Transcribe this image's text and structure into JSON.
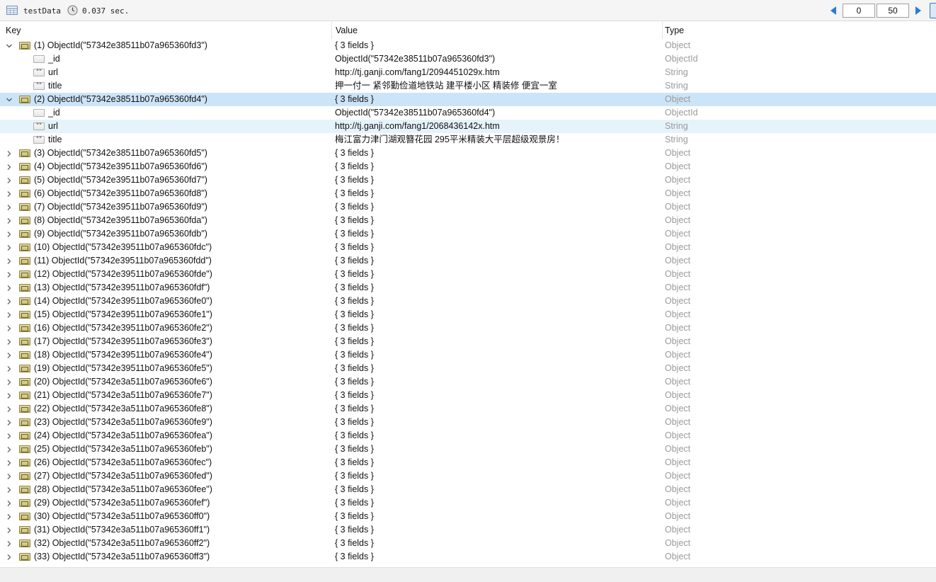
{
  "toolbar": {
    "collection": "testData",
    "time": "0.037 sec.",
    "skip": "0",
    "limit": "50",
    "icons": [
      "table-icon",
      "clock-icon",
      "prev-page-icon",
      "next-page-icon"
    ]
  },
  "columns": {
    "key": "Key",
    "value": "Value",
    "type": "Type"
  },
  "colors": {
    "selected_row": "#cce4f7",
    "hover_row": "#e5f3fb",
    "type_text": "#9a9a9a",
    "accent": "#1f78d1"
  },
  "rows": [
    {
      "level": 0,
      "expanded": true,
      "icon": "object",
      "key": "(1) ObjectId(\"57342e38511b07a965360fd3\")",
      "value": "{ 3 fields }",
      "type": "Object"
    },
    {
      "level": 1,
      "icon": "objectid",
      "key": "_id",
      "value": "ObjectId(\"57342e38511b07a965360fd3\")",
      "type": "ObjectId"
    },
    {
      "level": 1,
      "icon": "string",
      "key": "url",
      "value": "http://tj.ganji.com/fang1/2094451029x.htm",
      "type": "String"
    },
    {
      "level": 1,
      "icon": "string",
      "key": "title",
      "value": "押一付一 紧邻勤俭道地铁站 建平楼小区 精装修 便宜一室",
      "type": "String"
    },
    {
      "level": 0,
      "expanded": true,
      "selected": true,
      "icon": "object",
      "key": "(2) ObjectId(\"57342e38511b07a965360fd4\")",
      "value": "{ 3 fields }",
      "type": "Object"
    },
    {
      "level": 1,
      "icon": "objectid",
      "key": "_id",
      "value": "ObjectId(\"57342e38511b07a965360fd4\")",
      "type": "ObjectId"
    },
    {
      "level": 1,
      "hover": true,
      "icon": "string",
      "key": "url",
      "value": "http://tj.ganji.com/fang1/2068436142x.htm",
      "type": "String"
    },
    {
      "level": 1,
      "icon": "string",
      "key": "title",
      "value": "梅江富力津门湖观簪花园 295平米精装大平层超级观景房！",
      "type": "String"
    },
    {
      "level": 0,
      "icon": "object",
      "key": "(3) ObjectId(\"57342e38511b07a965360fd5\")",
      "value": "{ 3 fields }",
      "type": "Object"
    },
    {
      "level": 0,
      "icon": "object",
      "key": "(4) ObjectId(\"57342e39511b07a965360fd6\")",
      "value": "{ 3 fields }",
      "type": "Object"
    },
    {
      "level": 0,
      "icon": "object",
      "key": "(5) ObjectId(\"57342e39511b07a965360fd7\")",
      "value": "{ 3 fields }",
      "type": "Object"
    },
    {
      "level": 0,
      "icon": "object",
      "key": "(6) ObjectId(\"57342e39511b07a965360fd8\")",
      "value": "{ 3 fields }",
      "type": "Object"
    },
    {
      "level": 0,
      "icon": "object",
      "key": "(7) ObjectId(\"57342e39511b07a965360fd9\")",
      "value": "{ 3 fields }",
      "type": "Object"
    },
    {
      "level": 0,
      "icon": "object",
      "key": "(8) ObjectId(\"57342e39511b07a965360fda\")",
      "value": "{ 3 fields }",
      "type": "Object"
    },
    {
      "level": 0,
      "icon": "object",
      "key": "(9) ObjectId(\"57342e39511b07a965360fdb\")",
      "value": "{ 3 fields }",
      "type": "Object"
    },
    {
      "level": 0,
      "icon": "object",
      "key": "(10) ObjectId(\"57342e39511b07a965360fdc\")",
      "value": "{ 3 fields }",
      "type": "Object"
    },
    {
      "level": 0,
      "icon": "object",
      "key": "(11) ObjectId(\"57342e39511b07a965360fdd\")",
      "value": "{ 3 fields }",
      "type": "Object"
    },
    {
      "level": 0,
      "icon": "object",
      "key": "(12) ObjectId(\"57342e39511b07a965360fde\")",
      "value": "{ 3 fields }",
      "type": "Object"
    },
    {
      "level": 0,
      "icon": "object",
      "key": "(13) ObjectId(\"57342e39511b07a965360fdf\")",
      "value": "{ 3 fields }",
      "type": "Object"
    },
    {
      "level": 0,
      "icon": "object",
      "key": "(14) ObjectId(\"57342e39511b07a965360fe0\")",
      "value": "{ 3 fields }",
      "type": "Object"
    },
    {
      "level": 0,
      "icon": "object",
      "key": "(15) ObjectId(\"57342e39511b07a965360fe1\")",
      "value": "{ 3 fields }",
      "type": "Object"
    },
    {
      "level": 0,
      "icon": "object",
      "key": "(16) ObjectId(\"57342e39511b07a965360fe2\")",
      "value": "{ 3 fields }",
      "type": "Object"
    },
    {
      "level": 0,
      "icon": "object",
      "key": "(17) ObjectId(\"57342e39511b07a965360fe3\")",
      "value": "{ 3 fields }",
      "type": "Object"
    },
    {
      "level": 0,
      "icon": "object",
      "key": "(18) ObjectId(\"57342e39511b07a965360fe4\")",
      "value": "{ 3 fields }",
      "type": "Object"
    },
    {
      "level": 0,
      "icon": "object",
      "key": "(19) ObjectId(\"57342e39511b07a965360fe5\")",
      "value": "{ 3 fields }",
      "type": "Object"
    },
    {
      "level": 0,
      "icon": "object",
      "key": "(20) ObjectId(\"57342e3a511b07a965360fe6\")",
      "value": "{ 3 fields }",
      "type": "Object"
    },
    {
      "level": 0,
      "icon": "object",
      "key": "(21) ObjectId(\"57342e3a511b07a965360fe7\")",
      "value": "{ 3 fields }",
      "type": "Object"
    },
    {
      "level": 0,
      "icon": "object",
      "key": "(22) ObjectId(\"57342e3a511b07a965360fe8\")",
      "value": "{ 3 fields }",
      "type": "Object"
    },
    {
      "level": 0,
      "icon": "object",
      "key": "(23) ObjectId(\"57342e3a511b07a965360fe9\")",
      "value": "{ 3 fields }",
      "type": "Object"
    },
    {
      "level": 0,
      "icon": "object",
      "key": "(24) ObjectId(\"57342e3a511b07a965360fea\")",
      "value": "{ 3 fields }",
      "type": "Object"
    },
    {
      "level": 0,
      "icon": "object",
      "key": "(25) ObjectId(\"57342e3a511b07a965360feb\")",
      "value": "{ 3 fields }",
      "type": "Object"
    },
    {
      "level": 0,
      "icon": "object",
      "key": "(26) ObjectId(\"57342e3a511b07a965360fec\")",
      "value": "{ 3 fields }",
      "type": "Object"
    },
    {
      "level": 0,
      "icon": "object",
      "key": "(27) ObjectId(\"57342e3a511b07a965360fed\")",
      "value": "{ 3 fields }",
      "type": "Object"
    },
    {
      "level": 0,
      "icon": "object",
      "key": "(28) ObjectId(\"57342e3a511b07a965360fee\")",
      "value": "{ 3 fields }",
      "type": "Object"
    },
    {
      "level": 0,
      "icon": "object",
      "key": "(29) ObjectId(\"57342e3a511b07a965360fef\")",
      "value": "{ 3 fields }",
      "type": "Object"
    },
    {
      "level": 0,
      "icon": "object",
      "key": "(30) ObjectId(\"57342e3a511b07a965360ff0\")",
      "value": "{ 3 fields }",
      "type": "Object"
    },
    {
      "level": 0,
      "icon": "object",
      "key": "(31) ObjectId(\"57342e3a511b07a965360ff1\")",
      "value": "{ 3 fields }",
      "type": "Object"
    },
    {
      "level": 0,
      "icon": "object",
      "key": "(32) ObjectId(\"57342e3a511b07a965360ff2\")",
      "value": "{ 3 fields }",
      "type": "Object"
    },
    {
      "level": 0,
      "icon": "object",
      "key": "(33) ObjectId(\"57342e3a511b07a965360ff3\")",
      "value": "{ 3 fields }",
      "type": "Object"
    }
  ]
}
